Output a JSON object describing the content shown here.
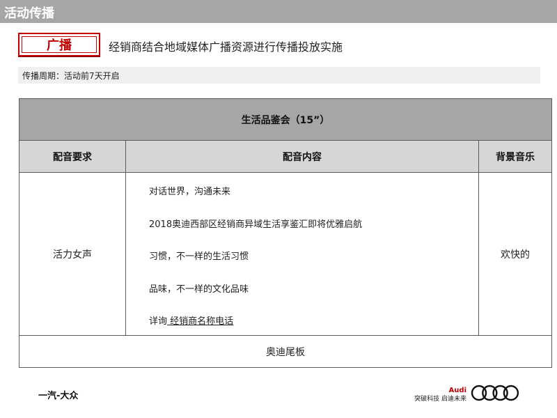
{
  "header": {
    "title": "活动传播"
  },
  "section": {
    "badge": "广播",
    "headline": "经销商结合地域媒体广播资源进行传播投放实施",
    "period": "传播周期：活动前7天开启"
  },
  "table": {
    "title": "生活品鉴会（15”）",
    "columns": [
      "配音要求",
      "配音内容",
      "背景音乐"
    ],
    "voice": "活力女声",
    "lines": [
      "对话世界，沟通未来",
      "2018奥迪西部区经销商异域生活享鉴汇即将优雅启航",
      "习惯，不一样的生活习惯",
      "品味，不一样的文化品味"
    ],
    "inquiry_prefix": "详询",
    "inquiry_link": " 经销商名称电话",
    "music": "欢快的",
    "footer": "奥迪尾板"
  },
  "footer": {
    "brand_left": "一汽-大众",
    "audi_brand": "Audi",
    "audi_slogan": "突破科技 启迪未来"
  },
  "colors": {
    "title_bar": "#a6a6a6",
    "accent_red": "#c00000",
    "header_gray": "#a6a6a6",
    "col_header_gray": "#d6d6d6"
  }
}
